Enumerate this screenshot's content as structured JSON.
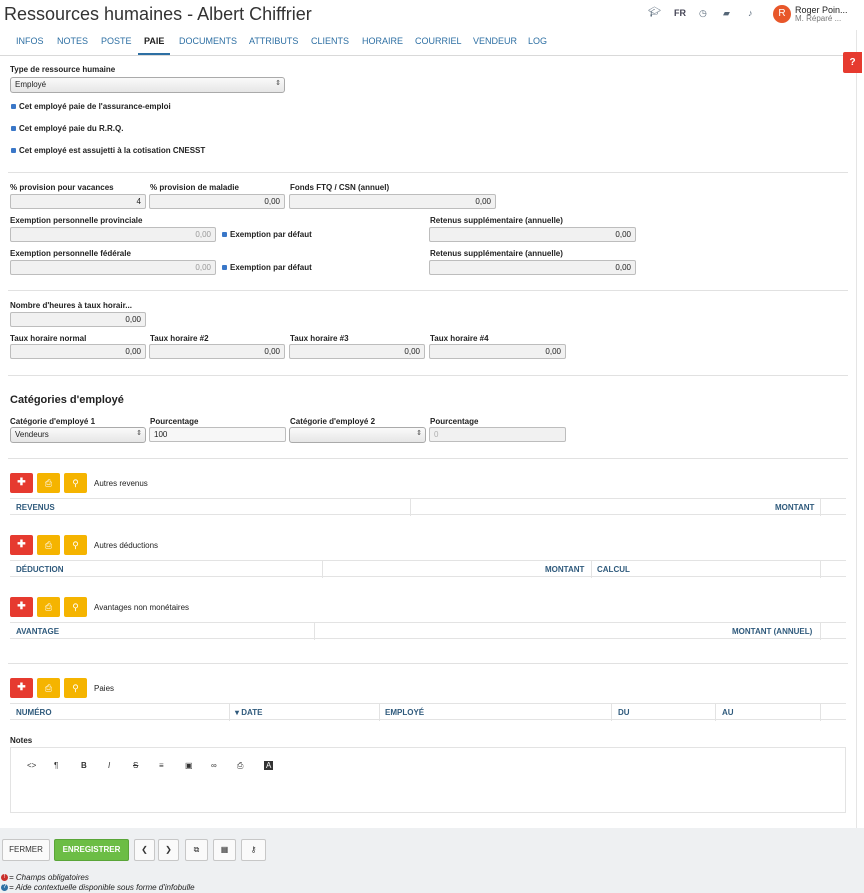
{
  "header": {
    "title": "Ressources humaines - Albert Chiffrier",
    "lang": "FR",
    "user_name": "Roger Poin...",
    "user_sub": "M. Réparé ...",
    "help_label": "?"
  },
  "tabs": [
    "INFOS",
    "NOTES",
    "POSTE",
    "PAIE",
    "DOCUMENTS",
    "ATTRIBUTS",
    "CLIENTS",
    "HORAIRE",
    "COURRIEL",
    "VENDEUR",
    "LOG"
  ],
  "active_tab": "PAIE",
  "hr_type": {
    "label": "Type de ressource humaine",
    "value": "Employé"
  },
  "checkboxes": [
    "Cet employé paie de l'assurance-emploi",
    "Cet employé paie du R.R.Q.",
    "Cet employé est assujetti à la cotisation CNESST"
  ],
  "provisions": {
    "vacation": {
      "label": "% provision pour vacances",
      "value": "4"
    },
    "sick": {
      "label": "% provision de maladie",
      "value": "0,00"
    },
    "ftq": {
      "label": "Fonds FTQ / CSN (annuel)",
      "value": "0,00"
    }
  },
  "exemptions": {
    "prov_label": "Exemption personnelle provinciale",
    "prov_value": "0,00",
    "fed_label": "Exemption personnelle fédérale",
    "fed_value": "0,00",
    "default_label": "Exemption par défaut",
    "retenus_label": "Retenus supplémentaire (annuelle)",
    "retenus_prov_value": "0,00",
    "retenus_fed_value": "0,00"
  },
  "hours": {
    "label": "Nombre d'heures à taux horair...",
    "value": "0,00"
  },
  "rates": [
    {
      "label": "Taux horaire normal",
      "value": "0,00"
    },
    {
      "label": "Taux horaire #2",
      "value": "0,00"
    },
    {
      "label": "Taux horaire #3",
      "value": "0,00"
    },
    {
      "label": "Taux horaire #4",
      "value": "0,00"
    }
  ],
  "categories": {
    "heading": "Catégories d'employé",
    "cat1_label": "Catégorie d'employé 1",
    "cat1_value": "Vendeurs",
    "pct1_label": "Pourcentage",
    "pct1_value": "100",
    "cat2_label": "Catégorie d'employé 2",
    "cat2_value": "",
    "pct2_label": "Pourcentage",
    "pct2_placeholder": "0"
  },
  "sections": {
    "revenus": {
      "label": "Autres revenus",
      "cols": [
        "REVENUS",
        "MONTANT"
      ]
    },
    "deductions": {
      "label": "Autres déductions",
      "cols": [
        "DÉDUCTION",
        "MONTANT",
        "CALCUL"
      ]
    },
    "avantages": {
      "label": "Avantages non monétaires",
      "cols": [
        "AVANTAGE",
        "MONTANT (ANNUEL)"
      ]
    },
    "paies": {
      "label": "Paies",
      "cols": [
        "NUMÉRO",
        "DATE",
        "EMPLOYÉ",
        "DU",
        "AU"
      ]
    }
  },
  "notes": {
    "label": "Notes",
    "toolbar": [
      "<>",
      "¶",
      "B",
      "I",
      "S",
      "≡",
      "▣",
      "∞",
      "⎙",
      "A"
    ]
  },
  "footer": {
    "close": "FERMER",
    "save": "ENREGISTRER",
    "legend_required": "= Champs obligatoires",
    "legend_help": "= Aide contextuelle disponible sous forme d'infobulle"
  },
  "colors": {
    "accent": "#2d6fa3",
    "danger": "#e63a2f",
    "warning": "#f5b400",
    "success": "#6cbd45"
  }
}
